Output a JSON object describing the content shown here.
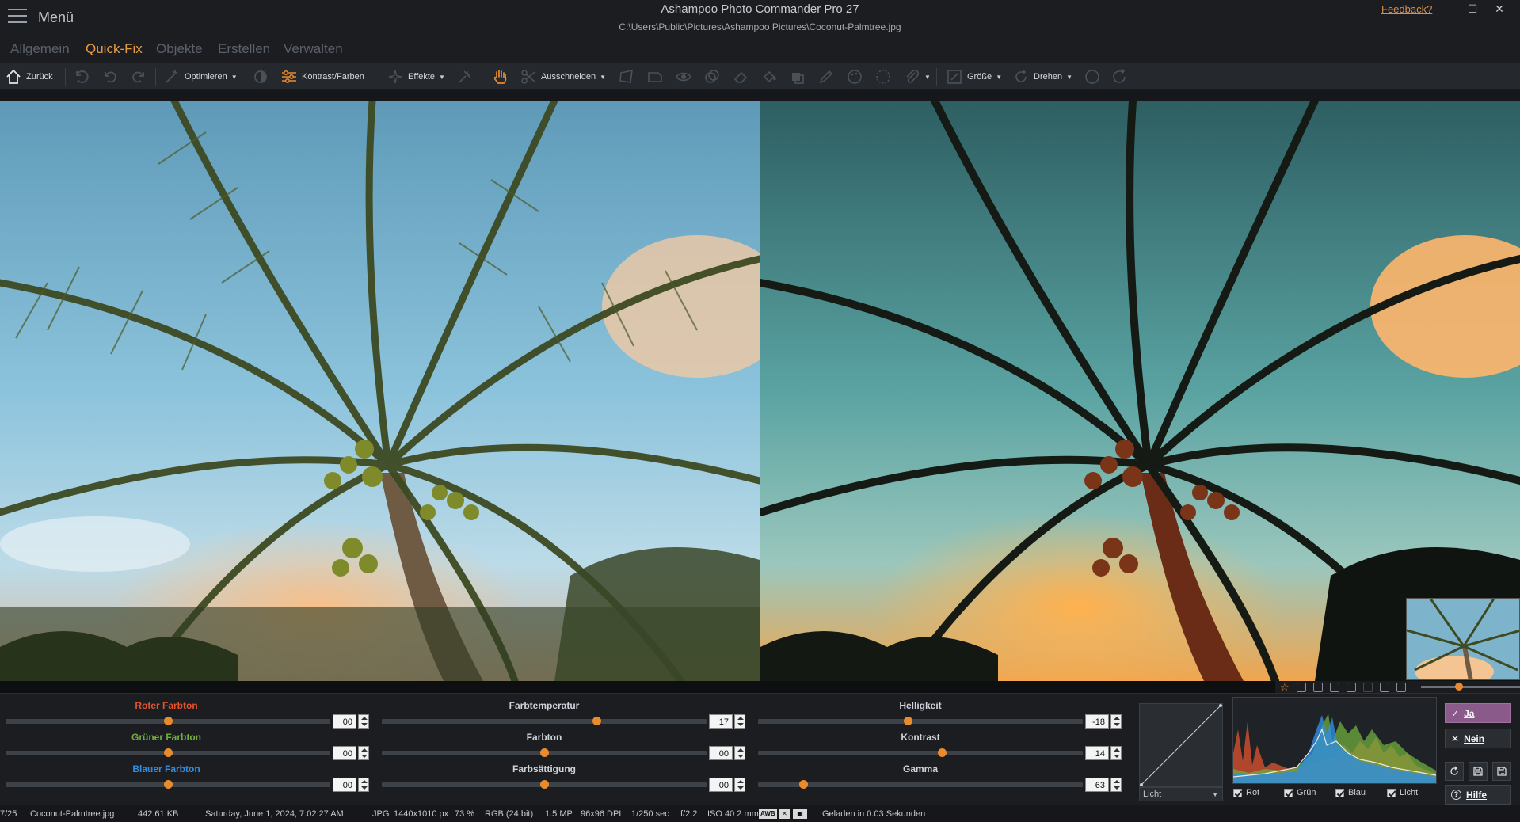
{
  "titlebar": {
    "menu_label": "Menü",
    "app_title": "Ashampoo Photo Commander Pro 27",
    "file_path": "C:\\Users\\Public\\Pictures\\Ashampoo Pictures\\Coconut-Palmtree.jpg",
    "feedback": "Feedback?",
    "minimize": "—",
    "maximize": "☐",
    "close": "✕"
  },
  "tabs": [
    "Allgemein",
    "Quick-Fix",
    "Objekte",
    "Erstellen",
    "Verwalten"
  ],
  "active_tab": "Quick-Fix",
  "toolbar": {
    "back": "Zurück",
    "optimize": "Optimieren",
    "contrast_colors": "Kontrast/Farben",
    "effects": "Effekte",
    "crop": "Ausschneiden",
    "size": "Größe",
    "rotate": "Drehen"
  },
  "sliders": {
    "col1": [
      {
        "label": "Roter Farbton",
        "value": "00",
        "color": "#e2532e",
        "position": 0.5
      },
      {
        "label": "Grüner Farbton",
        "value": "00",
        "color": "#6fae3f",
        "position": 0.5
      },
      {
        "label": "Blauer Farbton",
        "value": "00",
        "color": "#2f8fe0",
        "position": 0.5
      }
    ],
    "col2": [
      {
        "label": "Farbtemperatur",
        "value": "17",
        "position": 0.66
      },
      {
        "label": "Farbton",
        "value": "00",
        "position": 0.5
      },
      {
        "label": "Farbsättigung",
        "value": "00",
        "position": 0.5
      }
    ],
    "col3": [
      {
        "label": "Helligkeit",
        "value": "-18",
        "position": 0.46
      },
      {
        "label": "Kontrast",
        "value": "14",
        "position": 0.565
      },
      {
        "label": "Gamma",
        "value": "63",
        "position": 0.14
      }
    ]
  },
  "curve": {
    "channel": "Licht"
  },
  "histogram": {
    "channels": [
      "Rot",
      "Grün",
      "Blau",
      "Licht"
    ],
    "colors": {
      "Rot": "#e2532e",
      "Grün": "#6fae3f",
      "Blau": "#2f8fe0",
      "Licht": "#e8e8e8"
    }
  },
  "actions": {
    "yes": "Ja",
    "no": "Nein",
    "help": "Hilfe"
  },
  "zoom": {
    "position": 0.39
  },
  "status": {
    "index": "7/25",
    "filename": "Coconut-Palmtree.jpg",
    "filesize": "442.61 KB",
    "date": "Saturday, June 1, 2024, 7:02:27 AM",
    "format": "JPG",
    "dimensions": "1440x1010 px",
    "zoom": "73 %",
    "color_mode": "RGB (24 bit)",
    "megapixels": "1.5 MP",
    "dpi": "96x96 DPI",
    "shutter": "1/250 sec",
    "aperture": "f/2.2",
    "iso": "ISO 40 2 mm",
    "awb": "AWB",
    "loaded": "Geladen in 0.03 Sekunden"
  },
  "accent_color": "#e98b2c"
}
